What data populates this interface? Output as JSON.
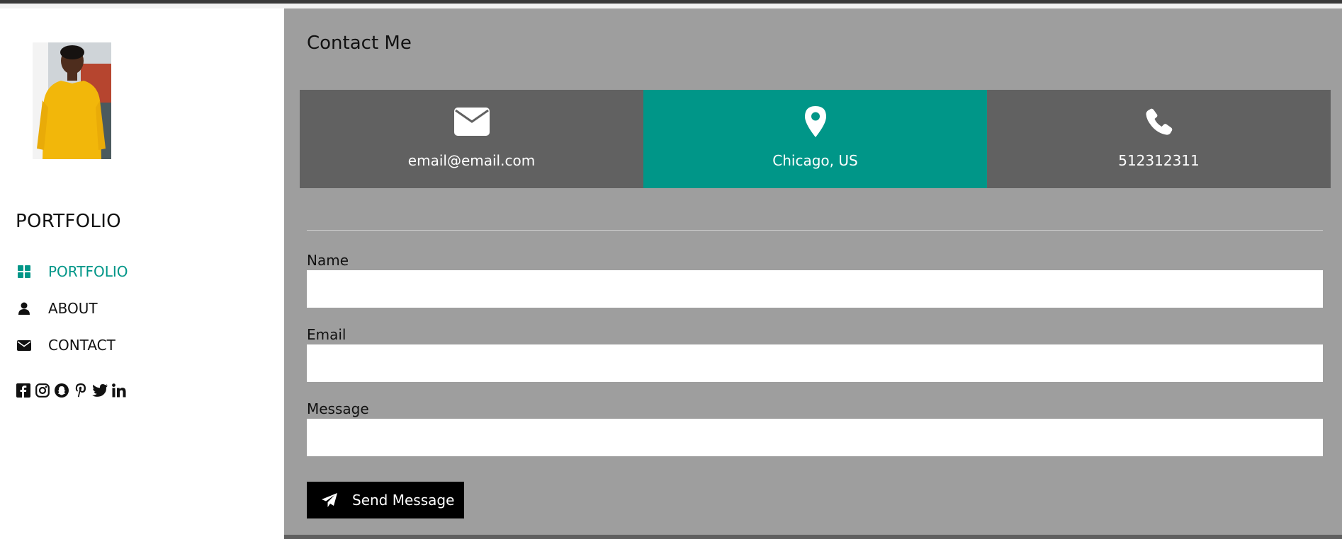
{
  "sidebar": {
    "title": "PORTFOLIO",
    "nav": [
      {
        "label": "PORTFOLIO",
        "icon": "grid-icon",
        "active": true
      },
      {
        "label": "ABOUT",
        "icon": "user-icon",
        "active": false
      },
      {
        "label": "CONTACT",
        "icon": "envelope-icon",
        "active": false
      }
    ],
    "socials": [
      "facebook-icon",
      "instagram-icon",
      "snapchat-icon",
      "pinterest-icon",
      "twitter-icon",
      "linkedin-icon"
    ]
  },
  "main": {
    "title": "Contact Me",
    "cards": [
      {
        "icon": "envelope-icon",
        "text": "email@email.com"
      },
      {
        "icon": "map-pin-icon",
        "text": "Chicago, US"
      },
      {
        "icon": "phone-icon",
        "text": "512312311"
      }
    ],
    "form": {
      "name_label": "Name",
      "name_value": "",
      "email_label": "Email",
      "email_value": "",
      "message_label": "Message",
      "message_value": "",
      "send_label": "Send Message"
    }
  },
  "colors": {
    "accent": "#009688",
    "main_bg": "#9e9e9e",
    "card_bg": "#616161",
    "button_bg": "#000000"
  }
}
